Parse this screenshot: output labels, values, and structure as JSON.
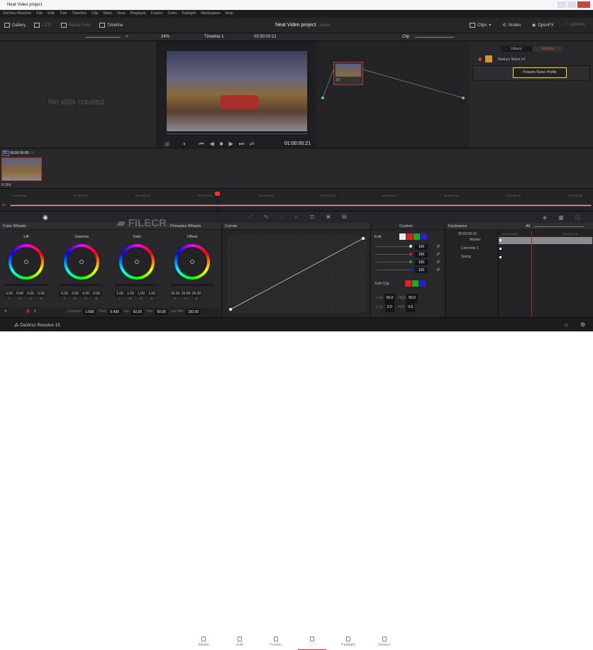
{
  "window": {
    "title": "Neat Video project"
  },
  "menu": [
    "DaVinci Resolve",
    "File",
    "Edit",
    "Trim",
    "Timeline",
    "Clip",
    "Mark",
    "View",
    "Playback",
    "Fusion",
    "Color",
    "Fairlight",
    "Workspace",
    "Help"
  ],
  "toolbar": {
    "left": [
      "Gallery",
      "LUTs",
      "Media Pool",
      "Timeline"
    ],
    "project": "Neat Video project",
    "status": "Edited",
    "right": [
      "Clips",
      "Nodes",
      "OpenFX",
      "Lightbox"
    ]
  },
  "viewer": {
    "zoom": "24%",
    "timeline": "Timeline 1",
    "timecode_top": "03:30:00:21",
    "timecode": "01:00:00:21",
    "mode": "Clip"
  },
  "gallery": {
    "empty": "No stills created"
  },
  "openfx": {
    "tabs": [
      "Library",
      "Settings"
    ],
    "active_tab": "Settings",
    "effect": "Reduce Noise v4",
    "button": "Prepare Noise Profile",
    "highlight": "#e8e020"
  },
  "node": {
    "label": "01"
  },
  "clip": {
    "index": "01",
    "timecode": "00:00:00:00",
    "track": "V1",
    "codec": "H.264"
  },
  "ruler": [
    "01:00:00:00",
    "01:00:00:07",
    "01:00:00:14",
    "01:00:00:21",
    "01:00:01:03",
    "01:00:01:10",
    "01:00:01:17",
    "01:00:01:24",
    "01:00:02:06",
    "01:00:02:13"
  ],
  "track": "V1",
  "color_wheels": {
    "title": "Color Wheels",
    "mode": "Primaries Wheels",
    "wheels": [
      {
        "name": "Lift",
        "values": [
          "0.00",
          "0.00",
          "0.00",
          "0.00"
        ],
        "labels": [
          "Y",
          "R",
          "G",
          "B"
        ]
      },
      {
        "name": "Gamma",
        "values": [
          "0.00",
          "0.00",
          "0.00",
          "0.00"
        ],
        "labels": [
          "Y",
          "R",
          "G",
          "B"
        ]
      },
      {
        "name": "Gain",
        "values": [
          "1.00",
          "1.00",
          "1.00",
          "1.00"
        ],
        "labels": [
          "Y",
          "R",
          "G",
          "B"
        ]
      },
      {
        "name": "Offset",
        "values": [
          "25.00",
          "25.00",
          "25.00"
        ],
        "labels": [
          "R",
          "G",
          "B"
        ]
      }
    ],
    "page1": "1",
    "page2": "2",
    "params": [
      {
        "label": "Contrast",
        "value": "1.000"
      },
      {
        "label": "Pivot",
        "value": "0.435"
      },
      {
        "label": "Sat",
        "value": "50.00"
      },
      {
        "label": "Hue",
        "value": "50.00"
      },
      {
        "label": "Lum Mix",
        "value": "100.00"
      }
    ]
  },
  "curves": {
    "title": "Curves",
    "preset": "Custom"
  },
  "edit": {
    "title": "Edit",
    "channels": [
      "Y",
      "R",
      "G",
      "B"
    ],
    "values": [
      "100",
      "100",
      "100",
      "100"
    ],
    "soft_clip": "Soft Clip",
    "low_label": "Low",
    "low": "50.0",
    "high_label": "High",
    "high": "50.0",
    "ls_label": "L.S.",
    "ls": "0.0",
    "hs_label": "H.S.",
    "hs": "0.0"
  },
  "keyframes": {
    "title": "Keyframes",
    "filter": "All",
    "timecode": "00:00:00:21",
    "ticks": [
      "00:00:00:08",
      "00:00:01:16"
    ],
    "rows": [
      "Master",
      "Corrector 1",
      "Sizing"
    ]
  },
  "pages": {
    "brand": "DaVinci Resolve 15",
    "items": [
      "Media",
      "Edit",
      "Fusion",
      "Color",
      "Fairlight",
      "Deliver"
    ],
    "active": "Color"
  },
  "watermark": "FILECR"
}
